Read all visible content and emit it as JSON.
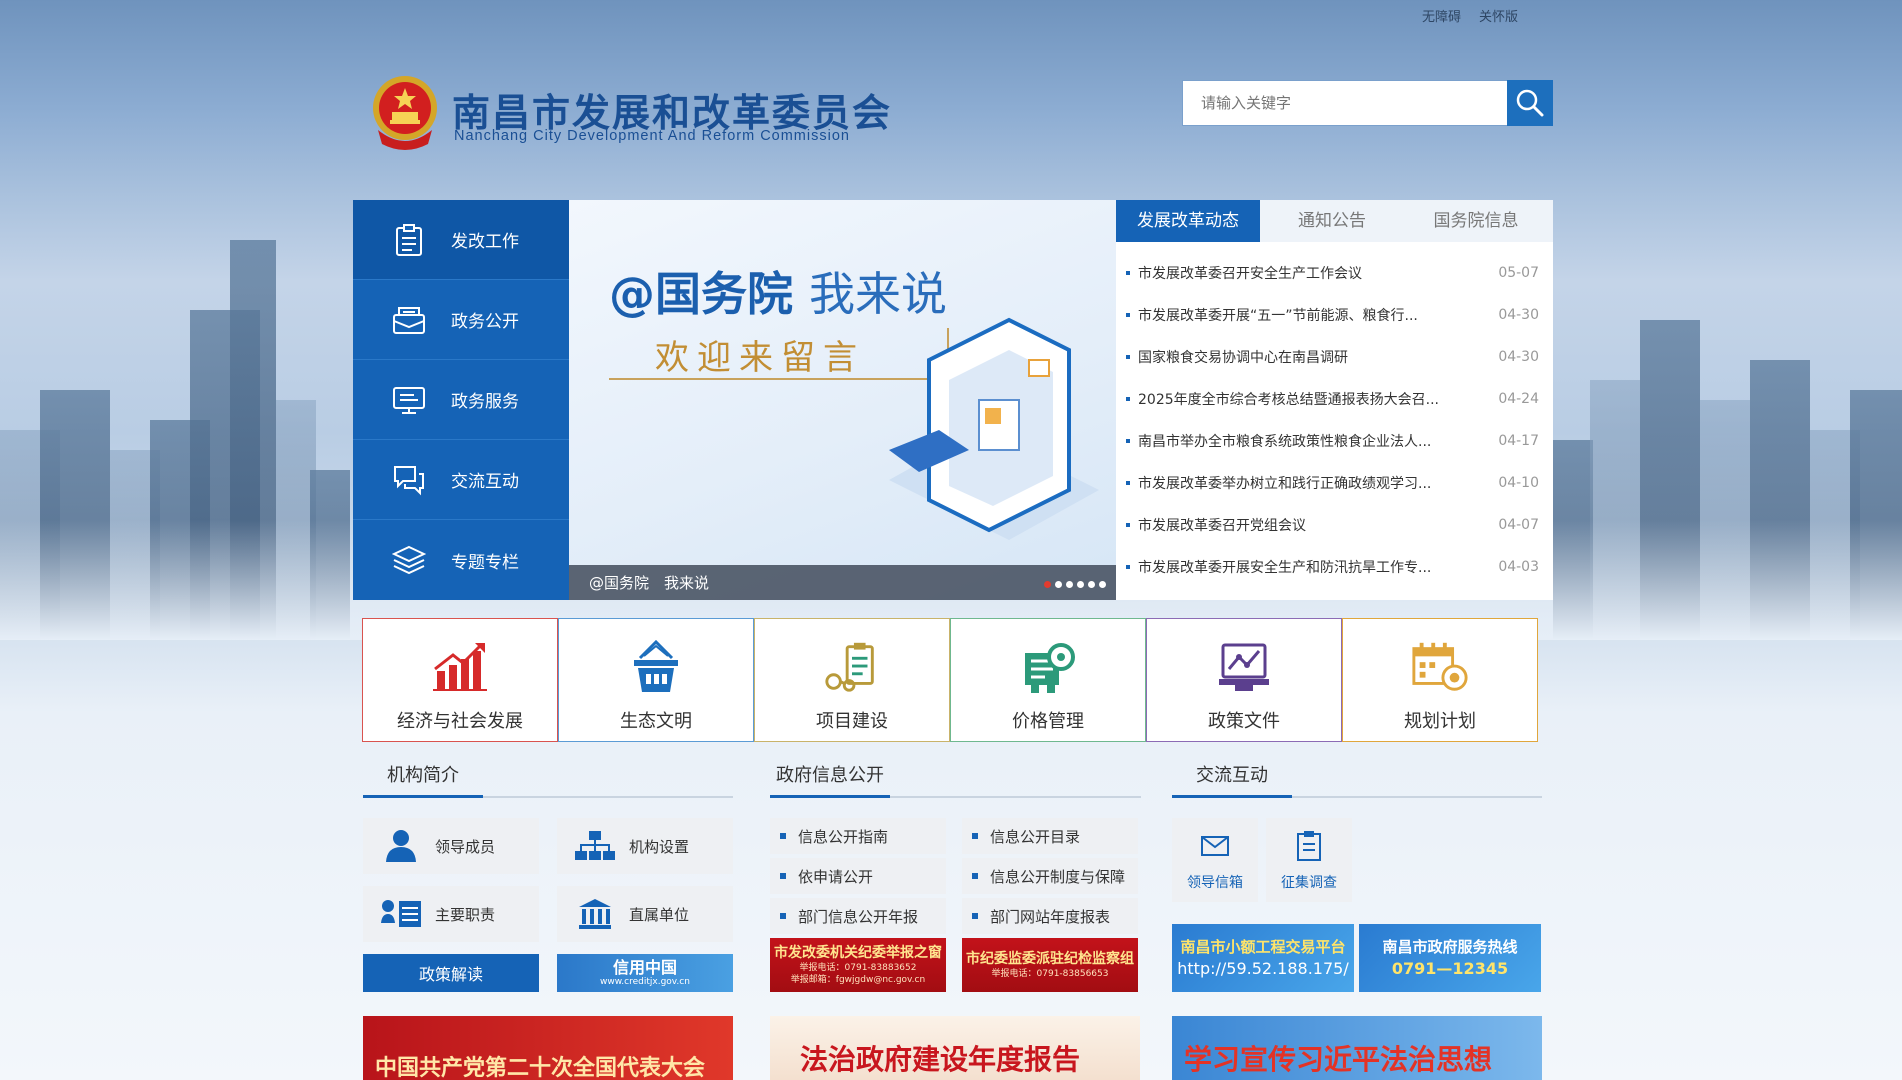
{
  "toplinks": {
    "accessible": "无障碍",
    "elder": "关怀版"
  },
  "header": {
    "title": "南昌市发展和改革委员会",
    "subtitle": "Nanchang City Development And Reform Commission"
  },
  "search": {
    "placeholder": "请输入关键字"
  },
  "leftnav": {
    "items": [
      {
        "label": "发改工作",
        "icon": "clipboard-icon"
      },
      {
        "label": "政务公开",
        "icon": "monitor-icon"
      },
      {
        "label": "政务服务",
        "icon": "presentation-icon"
      },
      {
        "label": "交流互动",
        "icon": "chat-icon"
      },
      {
        "label": "专题专栏",
        "icon": "layers-icon"
      }
    ]
  },
  "banner": {
    "title_main": "@国务院",
    "title_sub": "我来说",
    "welcome": "欢迎来留言",
    "caption": "@国务院　我来说"
  },
  "news": {
    "tabs": [
      "发展改革动态",
      "通知公告",
      "国务院信息"
    ],
    "items": [
      {
        "title": "市发展改革委召开安全生产工作会议",
        "date": "05-07"
      },
      {
        "title": "市发展改革委开展“五一”节前能源、粮食行...",
        "date": "04-30"
      },
      {
        "title": "国家粮食交易协调中心在南昌调研",
        "date": "04-30"
      },
      {
        "title": "2025年度全市综合考核总结暨通报表扬大会召...",
        "date": "04-24"
      },
      {
        "title": "南昌市举办全市粮食系统政策性粮食企业法人...",
        "date": "04-17"
      },
      {
        "title": "市发展改革委举办树立和践行正确政绩观学习...",
        "date": "04-10"
      },
      {
        "title": "市发展改革委召开党组会议",
        "date": "04-07"
      },
      {
        "title": "市发展改革委开展安全生产和防汛抗旱工作专...",
        "date": "04-03"
      }
    ]
  },
  "tiles": [
    {
      "label": "经济与社会发展",
      "icon": "bar-chart-icon",
      "border": "#d9534f"
    },
    {
      "label": "生态文明",
      "icon": "basket-icon",
      "border": "#5b9bd5"
    },
    {
      "label": "项目建设",
      "icon": "project-icon",
      "border": "#c9b36a"
    },
    {
      "label": "价格管理",
      "icon": "price-icon",
      "border": "#6fb88f"
    },
    {
      "label": "政策文件",
      "icon": "policy-icon",
      "border": "#8c6bb5"
    },
    {
      "label": "规划计划",
      "icon": "calendar-icon",
      "border": "#e0a63c"
    }
  ],
  "sections": {
    "org": {
      "title": "机构简介",
      "buttons": [
        "领导成员",
        "机构设置",
        "主要职责",
        "直属单位"
      ],
      "policy": "政策解读",
      "credit_title": "信用中国",
      "credit_url": "www.creditjx.gov.cn"
    },
    "info": {
      "title": "政府信息公开",
      "links": [
        "信息公开指南",
        "信息公开目录",
        "依申请公开",
        "信息公开制度与保障",
        "部门信息公开年报",
        "部门网站年度报表"
      ],
      "banner1_title": "市发改委机关纪委举报之窗",
      "banner1_tel": "举报电话：0791-83883652",
      "banner1_mail": "举报邮箱：fgwjgdw@nc.gov.cn",
      "banner2_title": "市纪委监委派驻纪检监察组",
      "banner2_tel": "举报电话：0791-83856653"
    },
    "interact": {
      "title": "交流互动",
      "buttons": [
        "领导信箱",
        "征集调查"
      ],
      "banner1_title": "南昌市小额工程交易平台",
      "banner1_url": "http://59.52.188.175/",
      "banner2_title": "南昌市政府服务热线",
      "banner2_tel": "0791—12345"
    }
  },
  "bottom_banners": [
    "中国共产党第二十次全国代表大会",
    "法治政府建设年度报告",
    "学习宣传习近平法治思想"
  ],
  "colors": {
    "primary": "#1563b6",
    "title": "#1a4f94",
    "red": "#c3121a"
  }
}
